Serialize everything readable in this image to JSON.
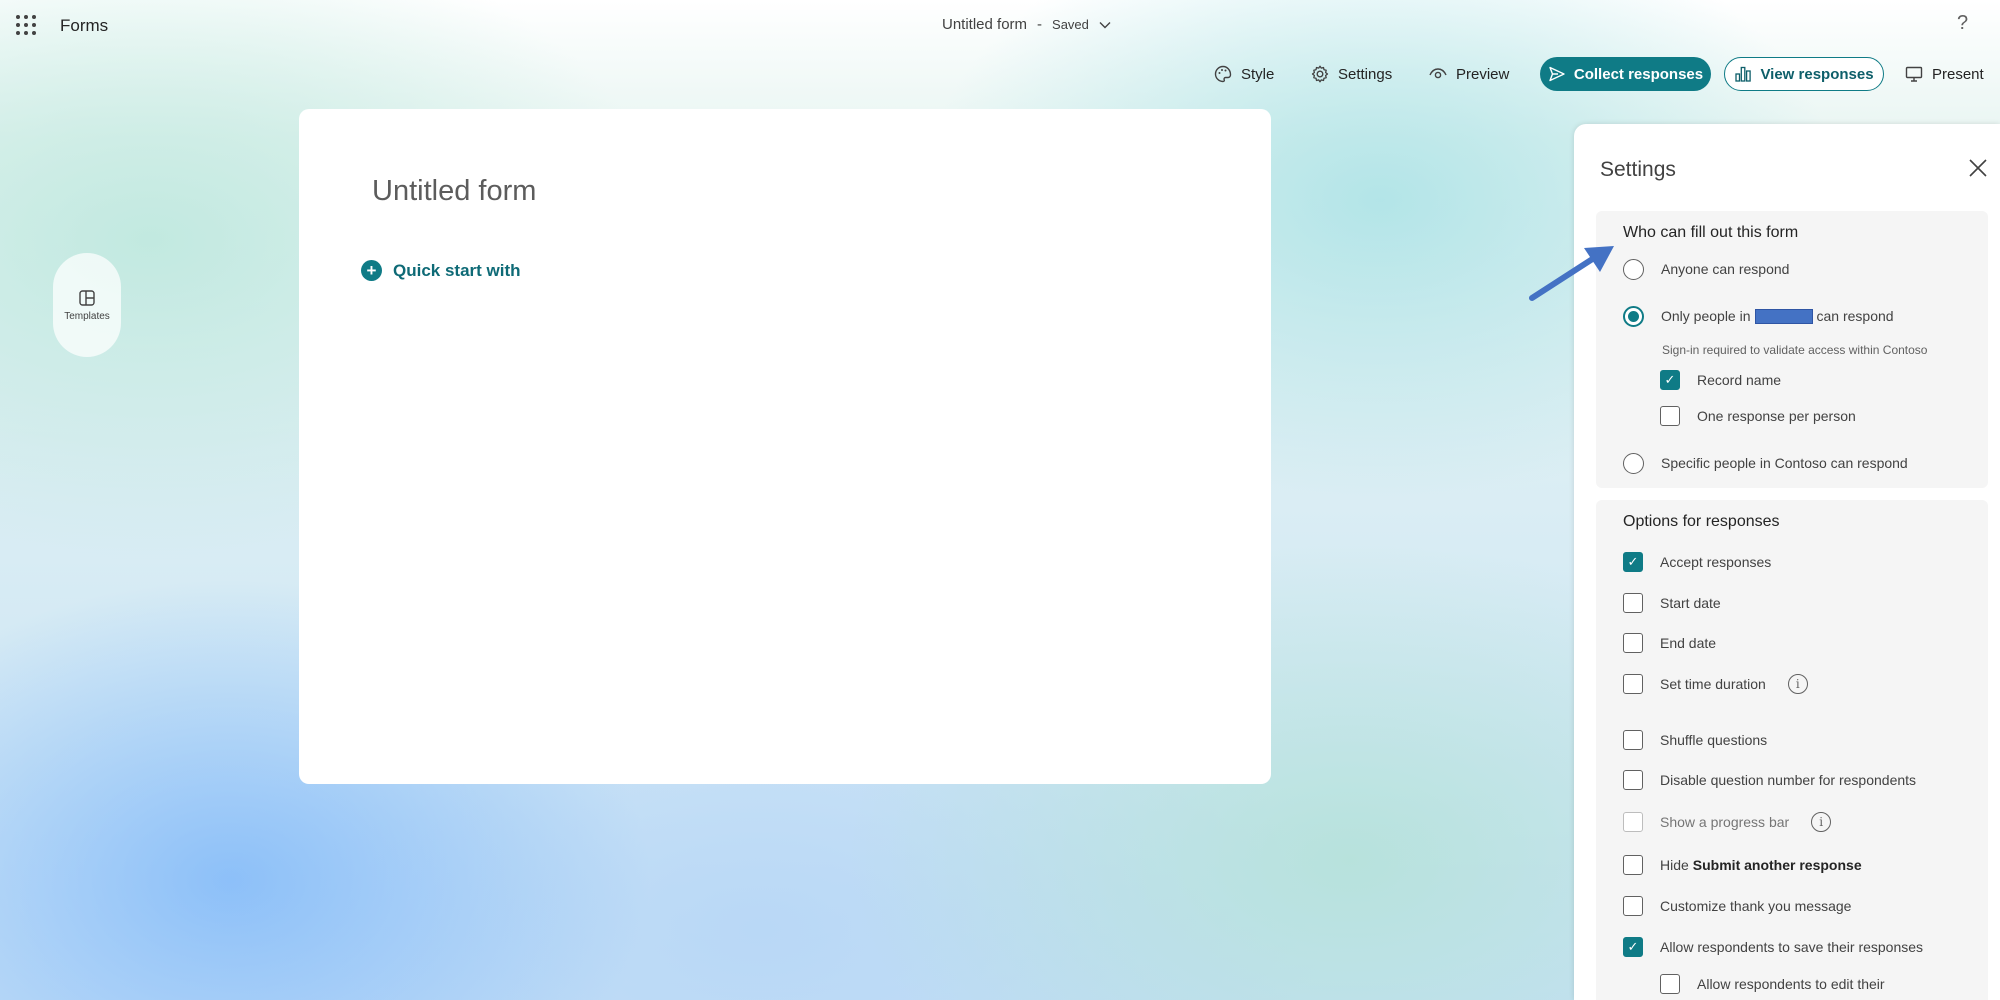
{
  "header": {
    "app_name": "Forms",
    "form_title": "Untitled form",
    "separator": "-",
    "save_status": "Saved",
    "help": "?"
  },
  "toolbar": {
    "style": "Style",
    "settings": "Settings",
    "preview": "Preview",
    "collect": "Collect responses",
    "view": "View responses",
    "present": "Present"
  },
  "sidebar": {
    "templates": "Templates"
  },
  "form": {
    "title": "Untitled form",
    "quick_start": "Quick start with"
  },
  "settings": {
    "title": "Settings",
    "who": {
      "heading": "Who can fill out this form",
      "anyone": "Anyone can respond",
      "only_prefix": "Only people in",
      "only_suffix": "can respond",
      "signin_hint": "Sign-in required to validate access within Contoso",
      "record_name": "Record name",
      "one_response": "One response per person",
      "specific": "Specific people in Contoso can respond",
      "selected": "only_people"
    },
    "options": {
      "heading": "Options for responses",
      "items": [
        {
          "label": "Accept responses",
          "checked": true
        },
        {
          "label": "Start date",
          "checked": false
        },
        {
          "label": "End date",
          "checked": false
        },
        {
          "label": "Set time duration",
          "checked": false
        },
        {
          "label": "Shuffle questions",
          "checked": false
        },
        {
          "label": "Disable question number for respondents",
          "checked": false
        },
        {
          "label": "Show a progress bar",
          "checked": false
        },
        {
          "label_prefix": "Hide",
          "label_bold": "Submit another response",
          "checked": false
        },
        {
          "label": "Customize thank you message",
          "checked": false
        },
        {
          "label": "Allow respondents to save their responses",
          "checked": true
        },
        {
          "label": "Allow respondents to edit their",
          "checked": false
        }
      ]
    }
  },
  "colors": {
    "accent": "#0f7b86",
    "redaction": "#4472c4",
    "annotation_arrow": "#4472c4"
  }
}
